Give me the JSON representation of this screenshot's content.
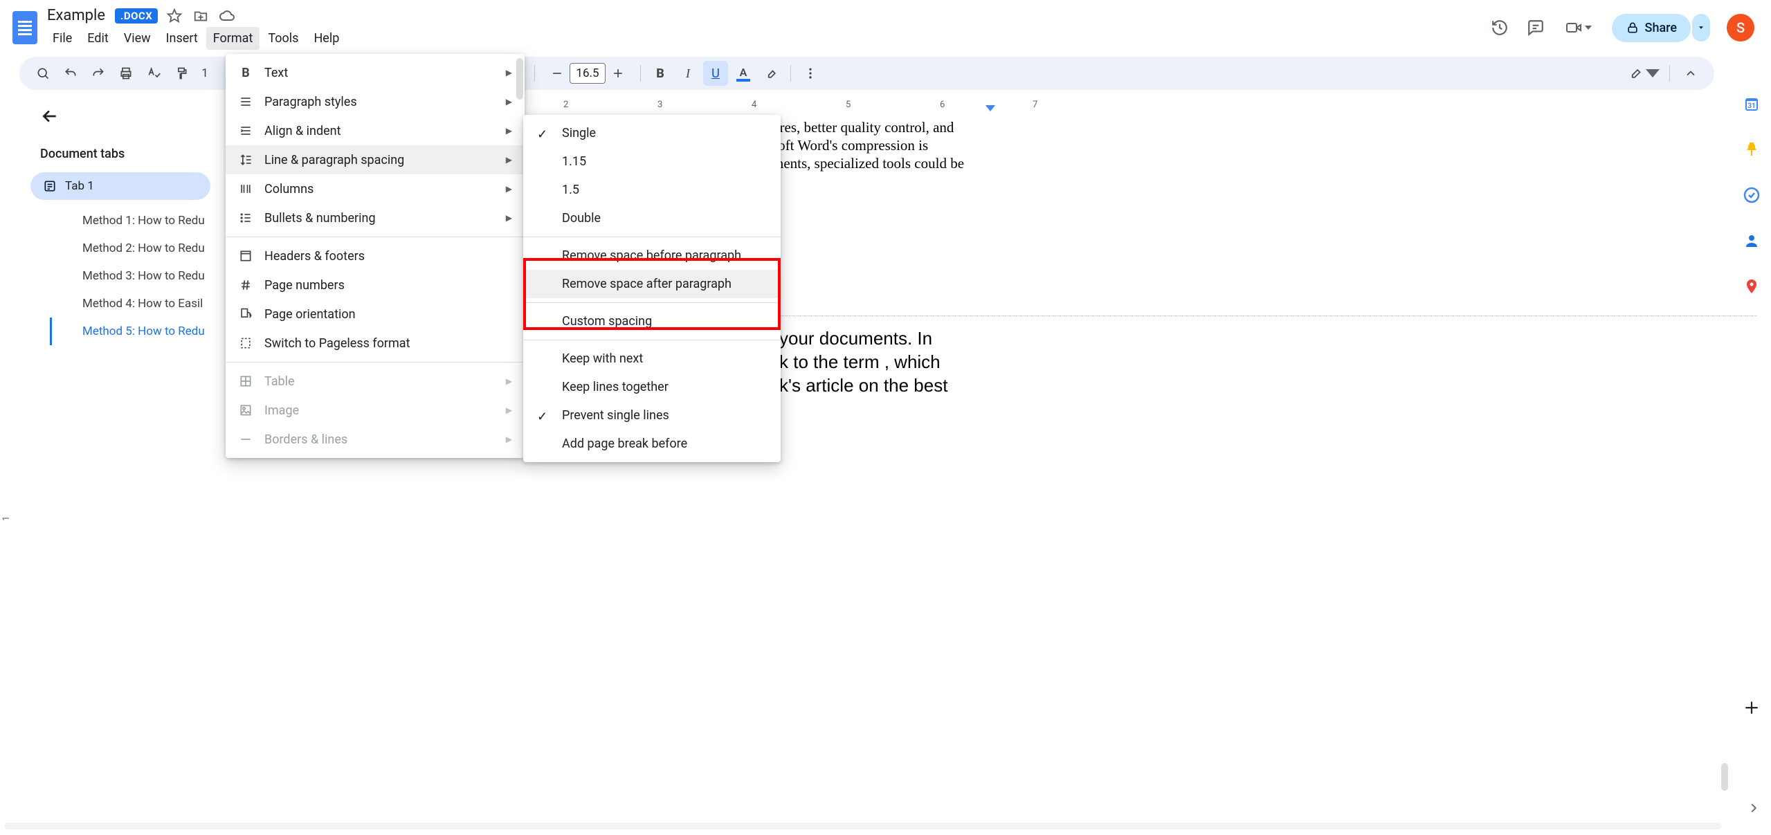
{
  "doc": {
    "title": "Example",
    "badge": ".DOCX"
  },
  "menubar": [
    "File",
    "Edit",
    "View",
    "Insert",
    "Format",
    "Tools",
    "Help"
  ],
  "topright": {
    "share": "Share",
    "avatar_letter": "S"
  },
  "toolbar": {
    "font_size": "16.5"
  },
  "left": {
    "panel_title": "Document tabs",
    "tab_chip": "Tab 1",
    "outline": [
      "Method 1: How to Redu",
      "Method 2: How to Redu",
      "Method 3: How to Redu",
      "Method 4: How to Easil",
      "Method 5: How to Redu"
    ]
  },
  "ruler_numbers": [
    "2",
    "3",
    "4",
    "5",
    "6",
    "7"
  ],
  "vruler_number": "1",
  "doc_text": {
    "l1": "ures, better quality control, and",
    "l2": "soft Word's compression is",
    "l3": "ments, specialized tools could be",
    "h1": " your documents. In",
    "h2": "k to the term , which",
    "h3": "k's article on the best"
  },
  "format_menu": [
    {
      "label": "Text",
      "arrow": true,
      "icon": "bold"
    },
    {
      "label": "Paragraph styles",
      "arrow": true,
      "icon": "para"
    },
    {
      "label": "Align & indent",
      "arrow": true,
      "icon": "align"
    },
    {
      "label": "Line & paragraph spacing",
      "arrow": true,
      "icon": "spacing",
      "hover": true
    },
    {
      "label": "Columns",
      "arrow": true,
      "icon": "columns"
    },
    {
      "label": "Bullets & numbering",
      "arrow": true,
      "icon": "bullets"
    },
    {
      "sep": true
    },
    {
      "label": "Headers & footers",
      "arrow": false,
      "icon": "headers"
    },
    {
      "label": "Page numbers",
      "arrow": false,
      "icon": "hash"
    },
    {
      "label": "Page orientation",
      "arrow": false,
      "icon": "orient"
    },
    {
      "label": "Switch to Pageless format",
      "arrow": false,
      "icon": "pageless"
    },
    {
      "sep": true
    },
    {
      "label": "Table",
      "arrow": true,
      "icon": "table",
      "disabled": true
    },
    {
      "label": "Image",
      "arrow": true,
      "icon": "image",
      "disabled": true
    },
    {
      "label": "Borders & lines",
      "arrow": true,
      "icon": "borders",
      "disabled": true
    }
  ],
  "spacing_menu": [
    {
      "label": "Single",
      "check": true
    },
    {
      "label": "1.15"
    },
    {
      "label": "1.5"
    },
    {
      "label": "Double"
    },
    {
      "sep": true
    },
    {
      "label": "Remove space before paragraph"
    },
    {
      "label": "Remove space after paragraph",
      "hover": true
    },
    {
      "sep": true
    },
    {
      "label": "Custom spacing"
    },
    {
      "sep": true
    },
    {
      "label": "Keep with next"
    },
    {
      "label": "Keep lines together"
    },
    {
      "label": "Prevent single lines",
      "check": true
    },
    {
      "label": "Add page break before"
    }
  ]
}
